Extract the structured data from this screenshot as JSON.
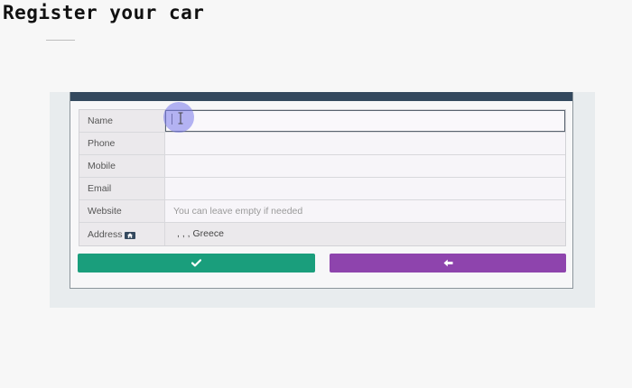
{
  "page": {
    "title": "Register your car"
  },
  "form": {
    "fields": [
      {
        "label": "Name",
        "value": "",
        "placeholder": ""
      },
      {
        "label": "Phone",
        "value": "",
        "placeholder": ""
      },
      {
        "label": "Mobile",
        "value": "",
        "placeholder": ""
      },
      {
        "label": "Email",
        "value": "",
        "placeholder": ""
      },
      {
        "label": "Website",
        "value": "",
        "placeholder": "You can leave empty if needed"
      }
    ],
    "address": {
      "label": "Address",
      "value": ", , , Greece"
    }
  },
  "buttons": {
    "save_icon": "check-icon",
    "back_icon": "arrow-left-icon"
  },
  "colors": {
    "topbar": "#34495e",
    "save": "#1a9e7c",
    "back": "#8e44ad"
  }
}
